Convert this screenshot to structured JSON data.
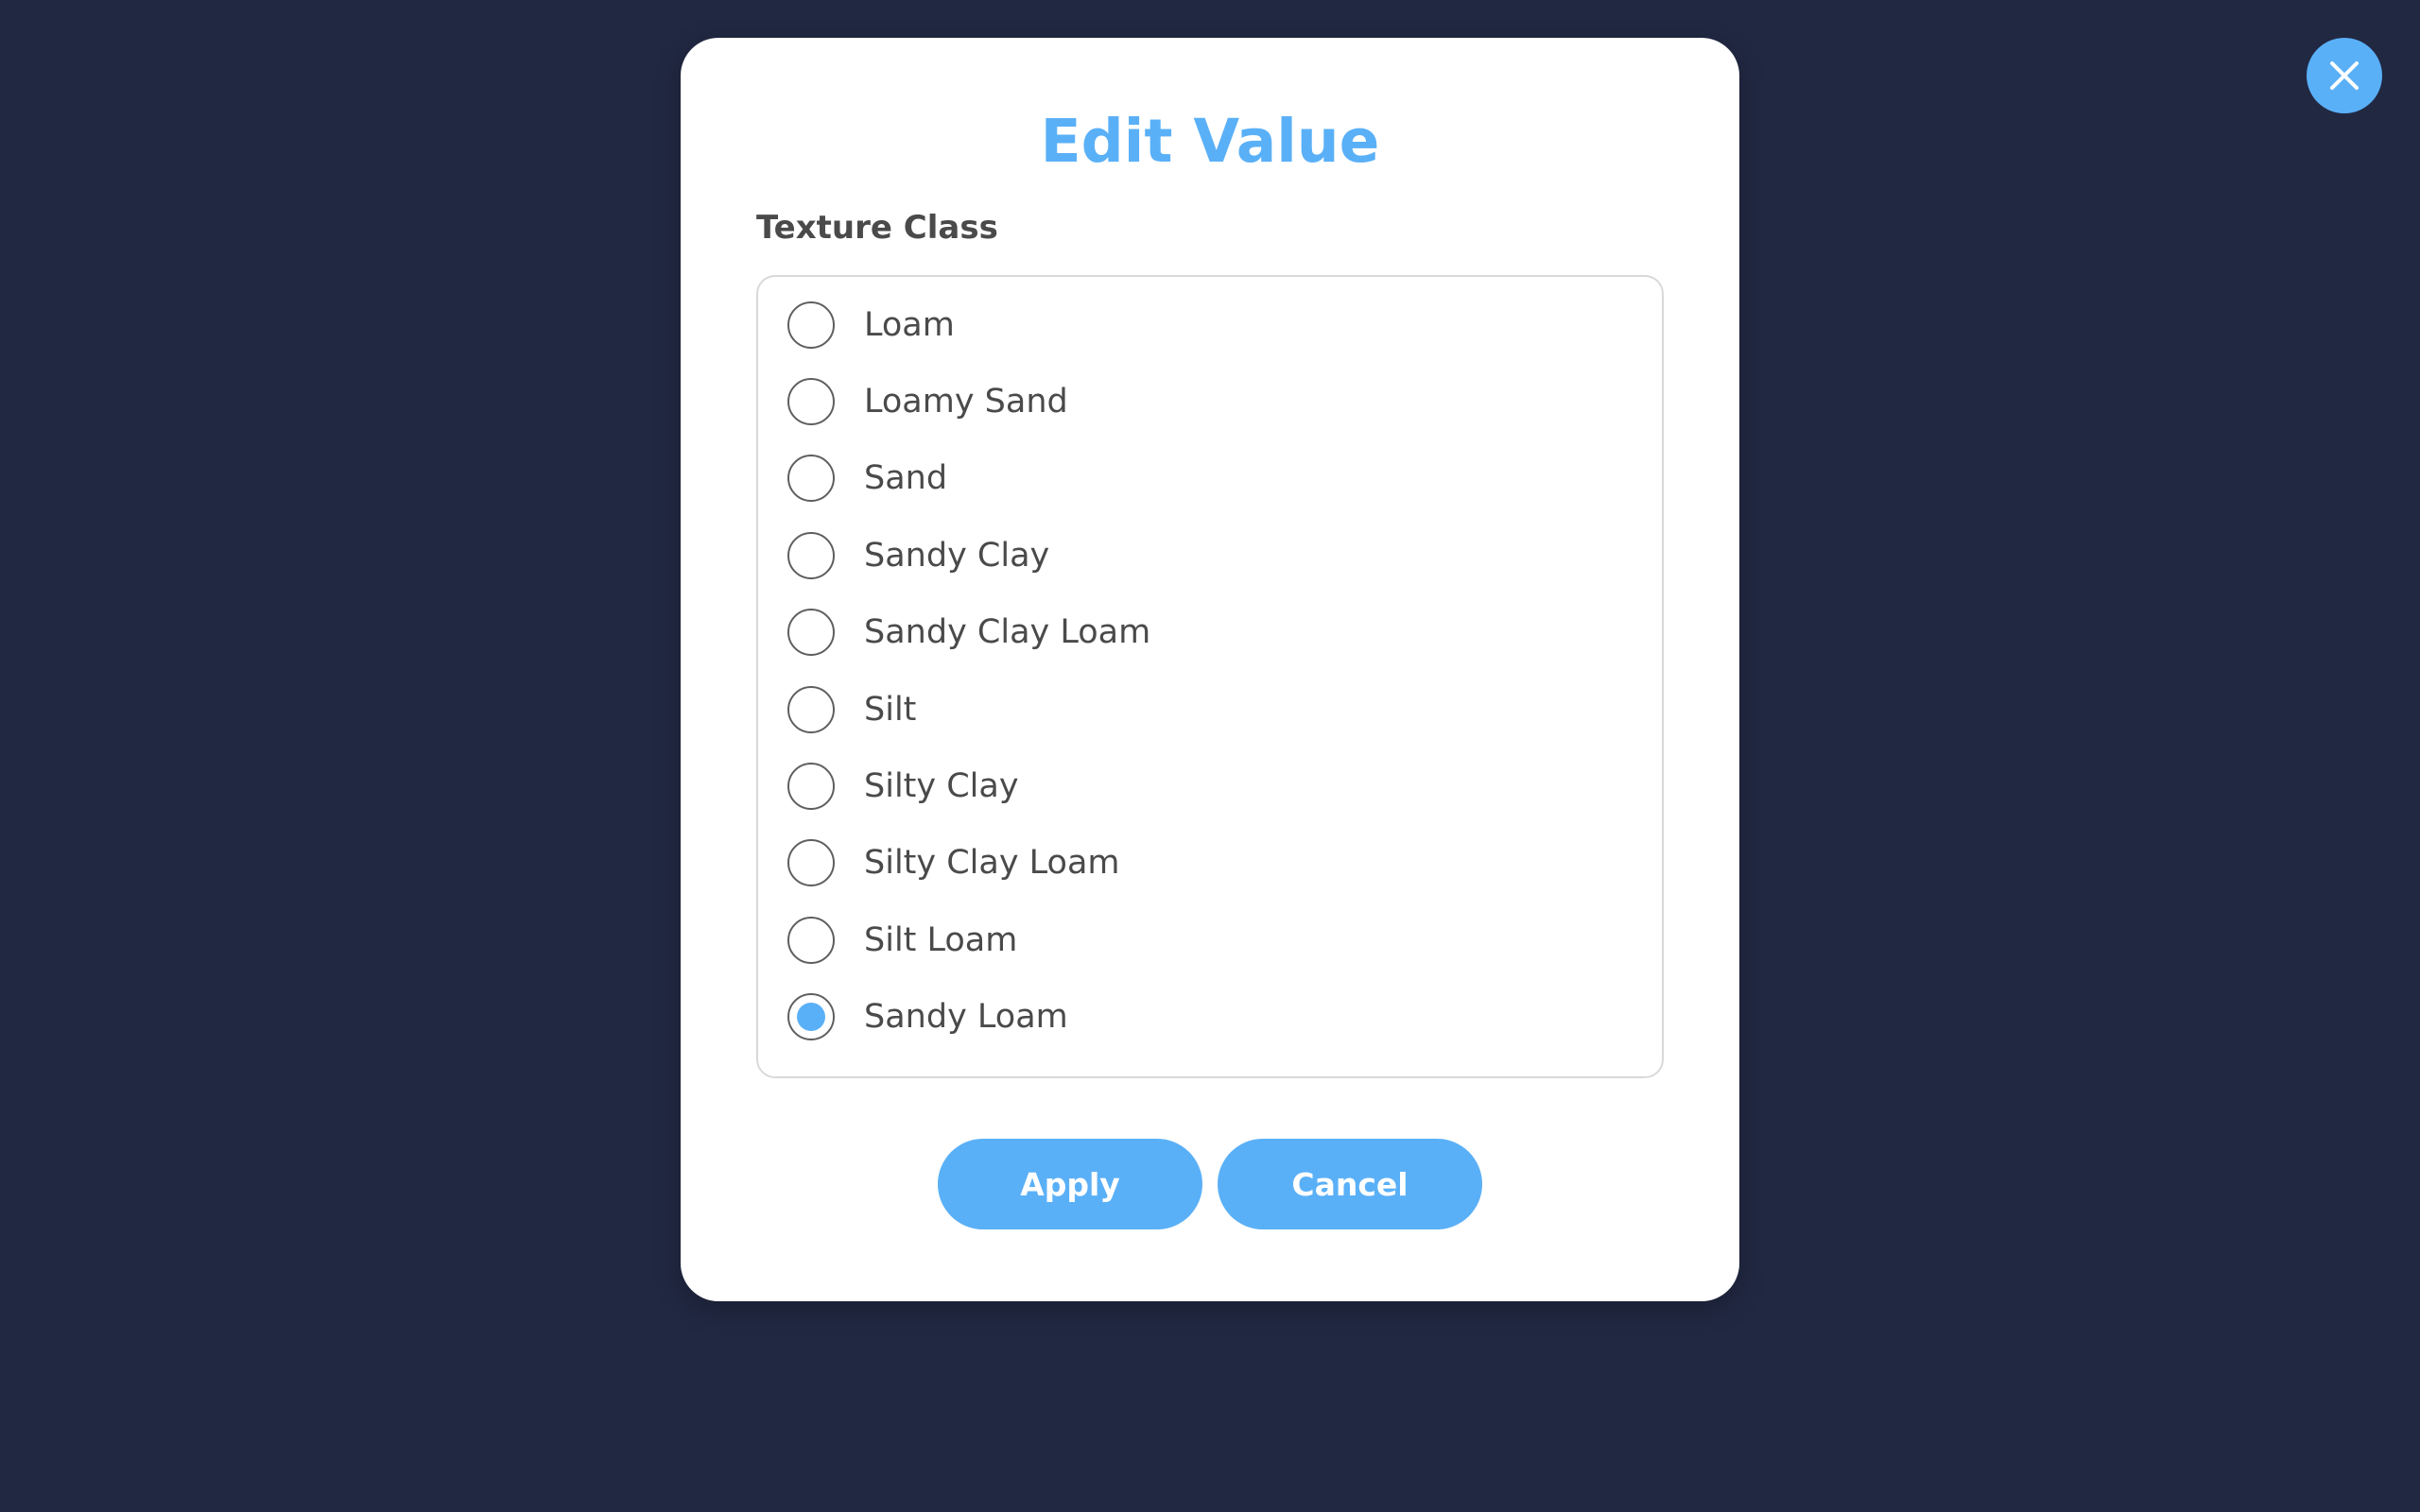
{
  "dialog": {
    "title": "Edit Value",
    "field_label": "Texture Class",
    "options": [
      {
        "label": "Loam",
        "selected": false
      },
      {
        "label": "Loamy Sand",
        "selected": false
      },
      {
        "label": "Sand",
        "selected": false
      },
      {
        "label": "Sandy Clay",
        "selected": false
      },
      {
        "label": "Sandy Clay Loam",
        "selected": false
      },
      {
        "label": "Silt",
        "selected": false
      },
      {
        "label": "Silty Clay",
        "selected": false
      },
      {
        "label": "Silty Clay Loam",
        "selected": false
      },
      {
        "label": "Silt Loam",
        "selected": false
      },
      {
        "label": "Sandy Loam",
        "selected": true
      }
    ],
    "apply_label": "Apply",
    "cancel_label": "Cancel"
  },
  "close_icon": "close-icon",
  "colors": {
    "background": "#212842",
    "accent": "#5ab0f7",
    "dialog": "#ffffff",
    "text": "#4a4a4a"
  }
}
